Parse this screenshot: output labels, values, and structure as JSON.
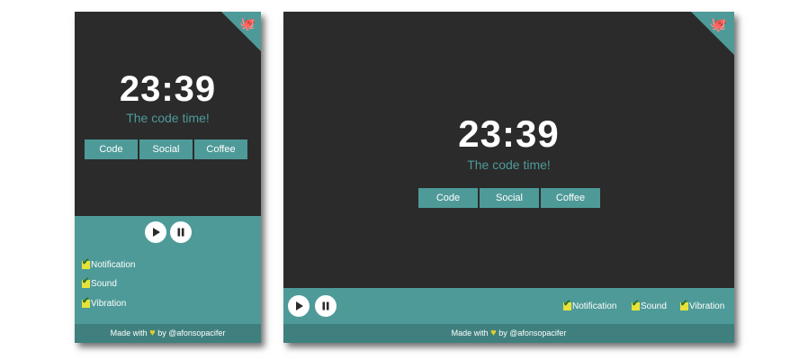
{
  "app": {
    "clock": "23:39",
    "subtitle": "The code time!",
    "modes": [
      "Code",
      "Social",
      "Coffee"
    ],
    "options": [
      "Notification",
      "Sound",
      "Vibration"
    ],
    "footer": {
      "prefix": "Made with",
      "suffix": "by @afonsopacifer"
    },
    "icons": {
      "corner": "github-octocat-icon",
      "play": "play-icon",
      "pause": "pause-icon",
      "heart": "heart-icon",
      "checkbox": "checkmark-icon"
    },
    "colors": {
      "background": "#2b2b2b",
      "accent": "#4e9a98",
      "footer": "#3f807e",
      "checkbox": "#e6e23a",
      "heart": "#e6cf2a"
    }
  }
}
